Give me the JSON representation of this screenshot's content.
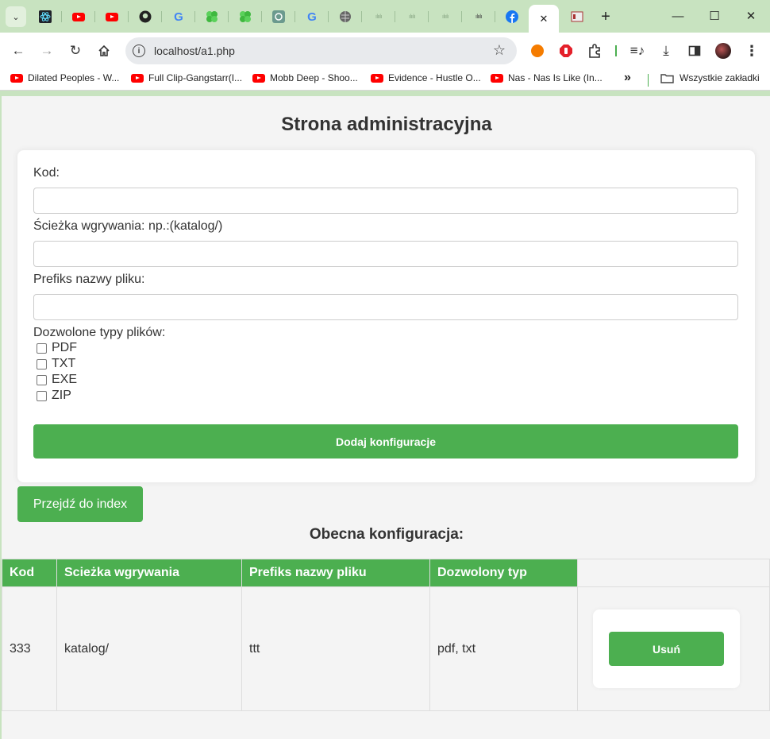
{
  "browser": {
    "url": "localhost/a1.php",
    "bookmarks": [
      {
        "label": "Dilated Peoples - W..."
      },
      {
        "label": "Full Clip-Gangstarr(I..."
      },
      {
        "label": "Mobb Deep - Shoo..."
      },
      {
        "label": "Evidence - Hustle O..."
      },
      {
        "label": "Nas - Nas Is Like (In..."
      }
    ],
    "bookmarks_overflow": "»",
    "all_bookmarks": "Wszystkie zakładki",
    "new_tab": "+",
    "close_tab": "✕",
    "minimize": "—",
    "maximize": "☐",
    "close_window": "✕"
  },
  "page": {
    "title": "Strona administracyjna",
    "form": {
      "kod_label": "Kod:",
      "sciezka_label": "Ścieżka wgrywania: np.:(katalog/)",
      "prefiks_label": "Prefiks nazwy pliku:",
      "typy_label": "Dozwolone typy plików:",
      "types": [
        "PDF",
        "TXT",
        "EXE",
        "ZIP"
      ],
      "submit_label": "Dodaj konfiguracje"
    },
    "index_button": "Przejdź do index",
    "current_config_title": "Obecna konfiguracja:",
    "table": {
      "headers": [
        "Kod",
        "Scieżka wgrywania",
        "Prefiks nazwy pliku",
        "Dozwolony typ"
      ],
      "rows": [
        {
          "kod": "333",
          "sciezka": "katalog/",
          "prefiks": "ttt",
          "typ": "pdf, txt",
          "delete_label": "Usuń"
        }
      ]
    }
  },
  "colors": {
    "chrome_bg": "#c8e3c0",
    "accent_green": "#4caf50",
    "page_bg": "#f4f4f4"
  }
}
